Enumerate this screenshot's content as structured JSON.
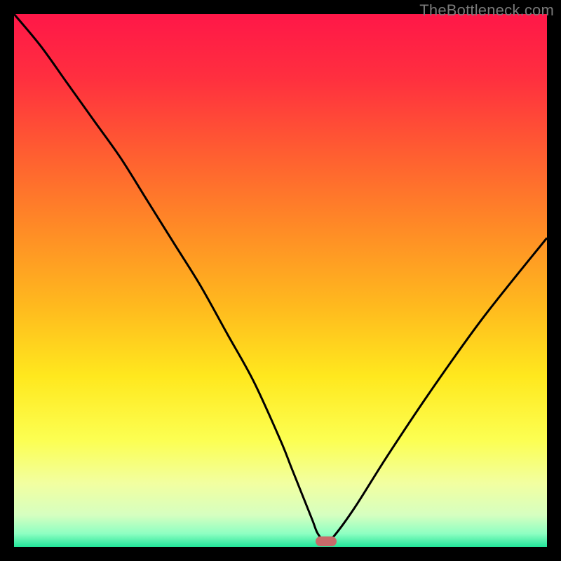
{
  "watermark": "TheBottleneck.com",
  "colors": {
    "frame_bg": "#000000",
    "watermark": "#7a7a7a",
    "curve": "#000000",
    "marker": "#c86a6a",
    "gradient_stops": [
      {
        "offset": 0.0,
        "color": "#ff1748"
      },
      {
        "offset": 0.12,
        "color": "#ff2f3f"
      },
      {
        "offset": 0.25,
        "color": "#ff5a32"
      },
      {
        "offset": 0.4,
        "color": "#ff8a26"
      },
      {
        "offset": 0.55,
        "color": "#ffba1e"
      },
      {
        "offset": 0.68,
        "color": "#ffe81e"
      },
      {
        "offset": 0.8,
        "color": "#fcff52"
      },
      {
        "offset": 0.88,
        "color": "#f2ffa0"
      },
      {
        "offset": 0.94,
        "color": "#d6ffc0"
      },
      {
        "offset": 0.975,
        "color": "#8effc2"
      },
      {
        "offset": 1.0,
        "color": "#22e59a"
      }
    ]
  },
  "chart_data": {
    "type": "line",
    "title": "",
    "xlabel": "",
    "ylabel": "",
    "xlim": [
      0,
      100
    ],
    "ylim": [
      0,
      100
    ],
    "grid": false,
    "series": [
      {
        "name": "bottleneck-curve",
        "x": [
          0,
          5,
          10,
          15,
          20,
          25,
          30,
          35,
          40,
          45,
          50,
          52,
          54,
          56,
          57,
          58.5,
          60,
          64,
          70,
          78,
          88,
          100
        ],
        "values": [
          100,
          94,
          87,
          80,
          73,
          65,
          57,
          49,
          40,
          31,
          20,
          15,
          10,
          5,
          2.5,
          1,
          2,
          7.5,
          17,
          29,
          43,
          58
        ]
      }
    ],
    "annotations": [
      {
        "name": "min-marker",
        "x": 58.5,
        "y": 1
      }
    ]
  }
}
